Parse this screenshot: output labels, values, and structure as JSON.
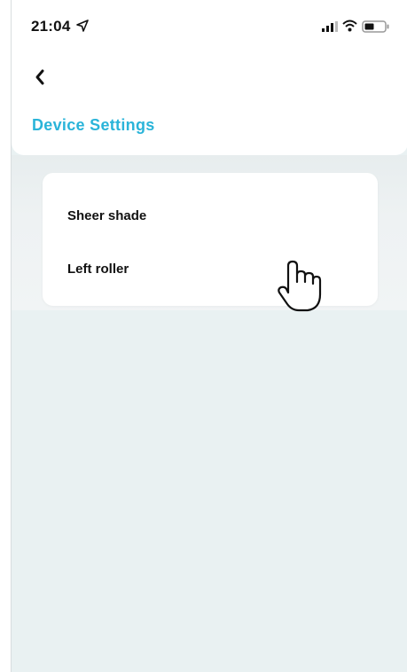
{
  "status_bar": {
    "time": "21:04",
    "icons": [
      "location-arrow-icon",
      "signal-icon",
      "wifi-icon",
      "battery-icon"
    ]
  },
  "nav": {
    "back_icon": "chevron-left-icon"
  },
  "page": {
    "title": "Device Settings"
  },
  "devices": {
    "items": [
      {
        "label": "Sheer shade"
      },
      {
        "label": "Left roller"
      }
    ]
  },
  "colors": {
    "accent": "#2ab4d9",
    "background": "#e9f1f2",
    "card": "#ffffff",
    "text": "#111111"
  },
  "cursor": {
    "icon": "hand-pointer-icon"
  }
}
